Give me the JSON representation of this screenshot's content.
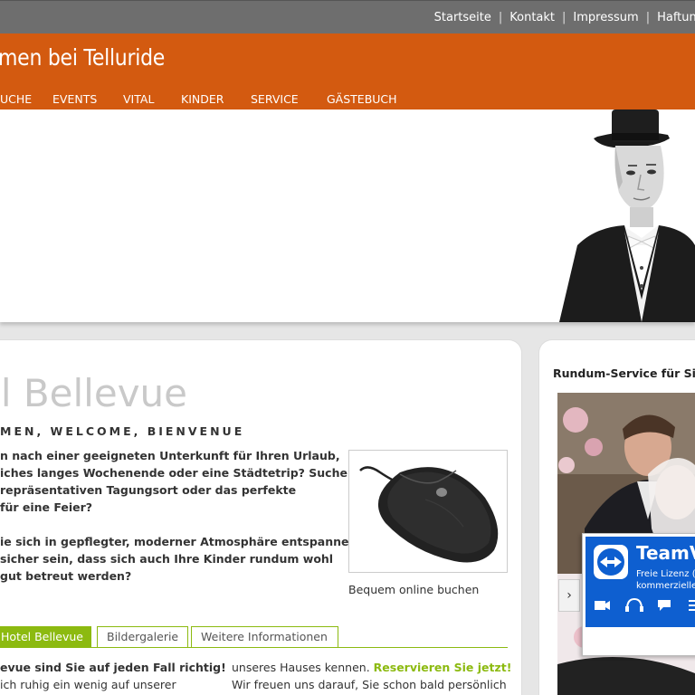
{
  "top_links": [
    "Startseite",
    "Kontakt",
    "Impressum",
    "Haftung"
  ],
  "site_title": "men bei Telluride",
  "nav": [
    "UCHE",
    "EVENTS",
    "VITAL",
    "KINDER",
    "SERVICE",
    "GÄSTEBUCH"
  ],
  "main": {
    "hotel_title": "el Bellevue",
    "welcome": "MEN, WELCOME, BIENVENUE",
    "intro_lines_1": [
      "n nach einer geeigneten Unterkunft für Ihren Urlaub,",
      "iches langes Wochenende oder eine Städtetrip? Suchen",
      "repräsentativen Tagungsort oder das perfekte",
      "für eine Feier?"
    ],
    "intro_lines_2": [
      "ie sich in gepflegter, moderner Atmosphäre entspannen",
      "sicher sein, dass sich auch Ihre Kinder rundum wohl",
      " gut betreut werden?"
    ],
    "promo_caption": "Bequem online buchen",
    "tabs": [
      "Hotel Bellevue",
      "Bildergalerie",
      "Weitere Informationen"
    ],
    "col1_lines": [
      "evue sind Sie auf jeden Fall richtig!",
      "ich ruhig ein wenig auf unserer"
    ],
    "col2_line1_text": "unseres Hauses kennen. ",
    "col2_line1_link": "Reservieren Sie jetzt!",
    "col2_line2": "Wir freuen uns darauf, Sie schon bald persönlich"
  },
  "sidebar": {
    "title": "Rundum-Service für Sie"
  },
  "teamviewer": {
    "title": "TeamV",
    "sub1": "Freie Lizenz (k",
    "sub2": "kommerzielle",
    "arrow": "›"
  },
  "colors": {
    "orange": "#d35a10",
    "green": "#8cba10",
    "teamviewer_blue": "#0e5fd0"
  }
}
